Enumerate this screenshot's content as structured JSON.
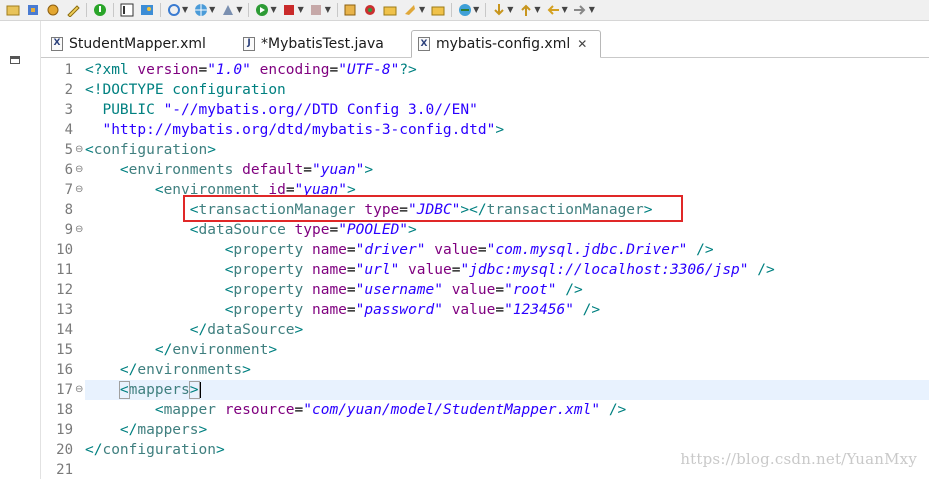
{
  "toolbar": {
    "icons": [
      "open-icon",
      "tools-icon",
      "settings-icon",
      "terminal-icon",
      "debug-icon",
      "image-icon",
      "refresh-icon",
      "globe-icon",
      "web-icon",
      "run-icon",
      "stop-icon",
      "build-icon",
      "profile-icon",
      "coverage-icon",
      "external-icon",
      "search-icon",
      "folder-icon",
      "task-icon",
      "folder2-icon",
      "search-globe-icon",
      "forward-icon",
      "back-icon",
      "nav-icon"
    ]
  },
  "tabs": [
    {
      "label": "StudentMapper.xml",
      "icon": "X"
    },
    {
      "label": "*MybatisTest.java",
      "icon": "J"
    },
    {
      "label": "mybatis-config.xml",
      "icon": "X",
      "active": true,
      "close": "✕"
    }
  ],
  "editor": {
    "lines": [
      {
        "n": "1",
        "fold": ""
      },
      {
        "n": "2",
        "fold": ""
      },
      {
        "n": "3",
        "fold": ""
      },
      {
        "n": "4",
        "fold": ""
      },
      {
        "n": "5",
        "fold": "⊖"
      },
      {
        "n": "6",
        "fold": "⊖"
      },
      {
        "n": "7",
        "fold": "⊖"
      },
      {
        "n": "8",
        "fold": ""
      },
      {
        "n": "9",
        "fold": "⊖"
      },
      {
        "n": "10",
        "fold": ""
      },
      {
        "n": "11",
        "fold": ""
      },
      {
        "n": "12",
        "fold": ""
      },
      {
        "n": "13",
        "fold": ""
      },
      {
        "n": "14",
        "fold": ""
      },
      {
        "n": "15",
        "fold": ""
      },
      {
        "n": "16",
        "fold": ""
      },
      {
        "n": "17",
        "fold": "⊖"
      },
      {
        "n": "18",
        "fold": ""
      },
      {
        "n": "19",
        "fold": ""
      },
      {
        "n": "20",
        "fold": ""
      },
      {
        "n": "21",
        "fold": ""
      }
    ],
    "code": {
      "l1": {
        "decl_open": "<?xml ",
        "a1": "version",
        "eq1": "=",
        "v1": "\"1.0\"",
        "a2": " encoding",
        "eq2": "=",
        "v2": "\"UTF-8\"",
        "decl_close": "?>"
      },
      "l2": {
        "text": "<!DOCTYPE configuration"
      },
      "l3": {
        "pre": "  PUBLIC ",
        "str": "\"-//mybatis.org//DTD Config 3.0//EN\""
      },
      "l4": {
        "pre": "  ",
        "str": "\"http://mybatis.org/dtd/mybatis-3-config.dtd\"",
        "post": ">"
      },
      "l5": {
        "open": "<",
        "tag": "configuration",
        "close": ">"
      },
      "l6": {
        "indent": "    ",
        "open": "<",
        "tag": "environments",
        "attr": " default",
        "eq": "=",
        "val": "\"yuan\"",
        "close": ">"
      },
      "l7": {
        "indent": "        ",
        "open": "<",
        "tag": "environment",
        "attr": " id",
        "eq": "=",
        "val": "\"yuan\"",
        "close": ">"
      },
      "l8": {
        "indent": "            ",
        "open": "<",
        "tag": "transactionManager",
        "attr": " type",
        "eq": "=",
        "val": "\"JDBC\"",
        "close": "></",
        "tag2": "transactionManager",
        "close2": ">"
      },
      "l9": {
        "indent": "            ",
        "open": "<",
        "tag": "dataSource",
        "attr": " type",
        "eq": "=",
        "val": "\"POOLED\"",
        "close": ">"
      },
      "l10": {
        "indent": "                ",
        "open": "<",
        "tag": "property",
        "a1": " name",
        "eq1": "=",
        "v1": "\"driver\"",
        "a2": " value",
        "eq2": "=",
        "v2": "\"com.mysql.jdbc.Driver\"",
        "close": " />"
      },
      "l11": {
        "indent": "                ",
        "open": "<",
        "tag": "property",
        "a1": " name",
        "eq1": "=",
        "v1": "\"url\"",
        "a2": " value",
        "eq2": "=",
        "v2": "\"jdbc:mysql://localhost:3306/jsp\"",
        "close": " />"
      },
      "l12": {
        "indent": "                ",
        "open": "<",
        "tag": "property",
        "a1": " name",
        "eq1": "=",
        "v1": "\"username\"",
        "a2": " value",
        "eq2": "=",
        "v2": "\"root\"",
        "close": " />"
      },
      "l13": {
        "indent": "                ",
        "open": "<",
        "tag": "property",
        "a1": " name",
        "eq1": "=",
        "v1": "\"password\"",
        "a2": " value",
        "eq2": "=",
        "v2": "\"123456\"",
        "close": " />"
      },
      "l14": {
        "indent": "            ",
        "open": "</",
        "tag": "dataSource",
        "close": ">"
      },
      "l15": {
        "indent": "        ",
        "open": "</",
        "tag": "environment",
        "close": ">"
      },
      "l16": {
        "indent": "    ",
        "open": "</",
        "tag": "environments",
        "close": ">"
      },
      "l17": {
        "indent": "    ",
        "open": "<",
        "tag": "mappers",
        "close": ">"
      },
      "l18": {
        "indent": "        ",
        "open": "<",
        "tag": "mapper",
        "attr": " resource",
        "eq": "=",
        "val": "\"com/yuan/model/StudentMapper.xml\"",
        "close": " />"
      },
      "l19": {
        "indent": "    ",
        "open": "</",
        "tag": "mappers",
        "close": ">"
      },
      "l20": {
        "open": "</",
        "tag": "configuration",
        "close": ">"
      }
    }
  },
  "watermark": "https://blog.csdn.net/YuanMxy",
  "colors": {
    "tag": "#3f7f7f",
    "attr": "#7f007f",
    "value": "#2a00ff",
    "highlight": "#e02828"
  }
}
